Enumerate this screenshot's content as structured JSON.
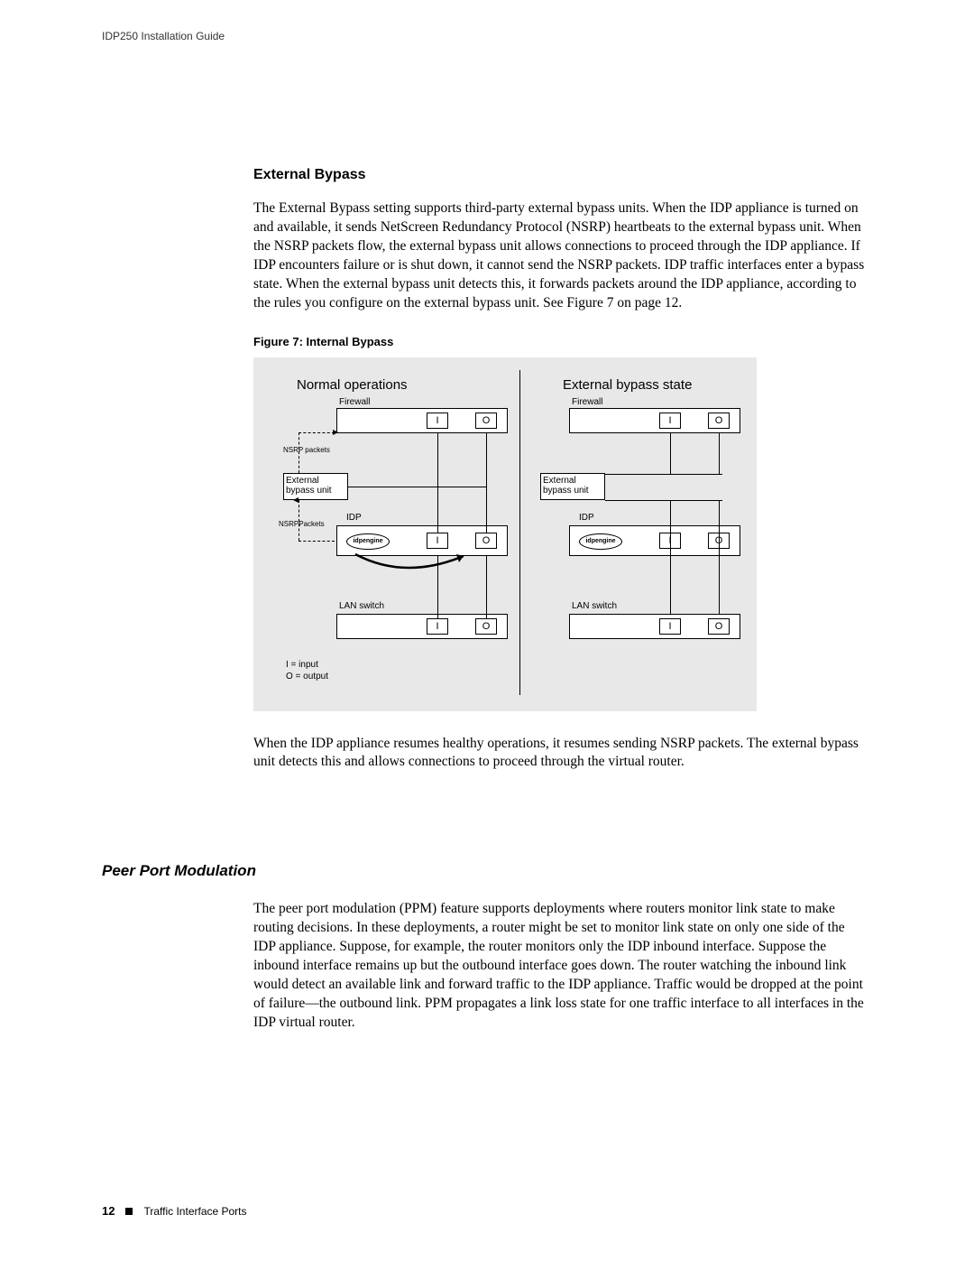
{
  "header": {
    "doc_title": "IDP250 Installation Guide"
  },
  "section1": {
    "heading": "External Bypass",
    "para1": "The External Bypass setting supports third-party external bypass units. When the IDP appliance is turned on and available, it sends NetScreen Redundancy Protocol (NSRP) heartbeats to the external bypass unit. When the NSRP packets flow, the external bypass unit allows connections to proceed through the IDP appliance. If IDP encounters failure or is shut down, it cannot send the NSRP packets. IDP traffic interfaces enter a bypass state. When the external bypass unit detects this, it forwards packets around the IDP appliance, according to the rules you configure on the external bypass unit. See Figure 7 on page 12."
  },
  "figure": {
    "caption": "Figure 7: Internal Bypass",
    "left_title": "Normal operations",
    "right_title": "External bypass state",
    "firewall": "Firewall",
    "ext_bypass": "External bypass unit",
    "idp": "IDP",
    "idpengine": "idpengine",
    "lan_switch": "LAN switch",
    "nsrp_packets1": "NSRP packets",
    "nsrp_packets2": "NSRPPackets",
    "port_i": "I",
    "port_o": "O",
    "legend_i": "I = input",
    "legend_o": "O = output"
  },
  "section1b": {
    "para2": "When the IDP appliance resumes healthy operations, it resumes sending NSRP packets. The external bypass unit detects this and allows connections to proceed through the virtual router."
  },
  "section2": {
    "heading": "Peer Port Modulation",
    "para1": "The peer port modulation (PPM) feature supports deployments where routers monitor link state to make routing decisions. In these deployments, a router might be set to monitor link state on only one side of the IDP appliance. Suppose, for example, the router monitors only the IDP inbound interface. Suppose the inbound interface remains up but the outbound interface goes down. The router watching the inbound link would detect an available link and forward traffic to the IDP appliance. Traffic would be dropped at the point of failure—the outbound link. PPM propagates a link loss state for one traffic interface to all interfaces in the IDP virtual router."
  },
  "footer": {
    "page_number": "12",
    "section_name": "Traffic Interface Ports"
  }
}
